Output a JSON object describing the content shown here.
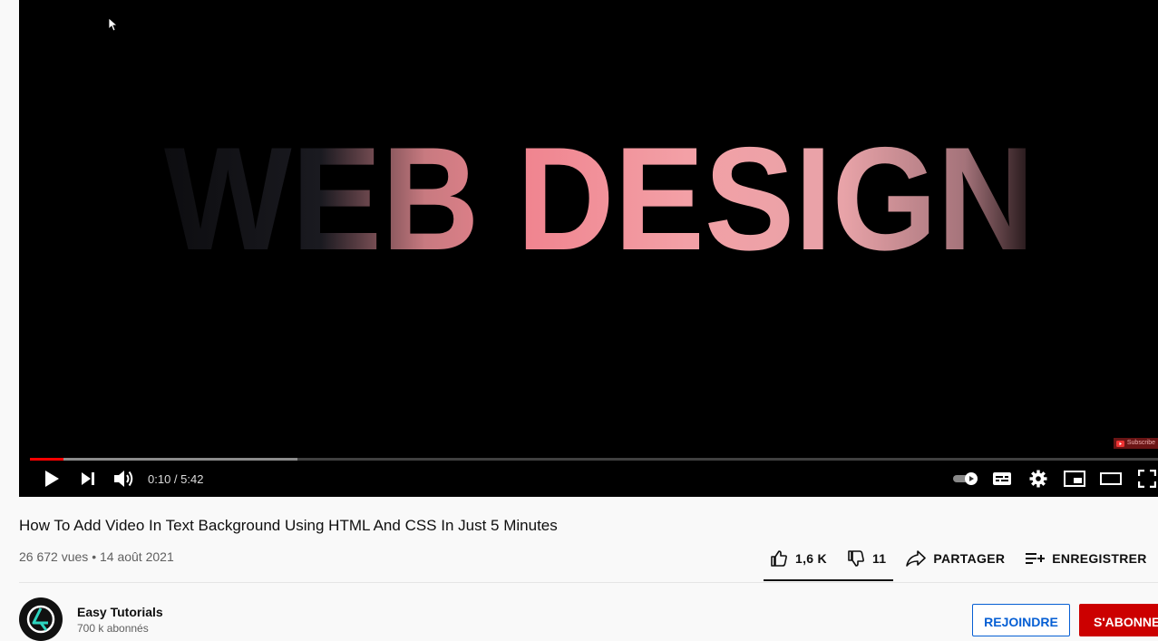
{
  "player": {
    "overlay_text": "WEB DESIGN",
    "subscribe_badge": "Subscribe",
    "time_display": "0:10 / 5:42",
    "progress_played_fraction": 0.03,
    "progress_buffered_fraction": 0.237,
    "accent_color": "#ff0000",
    "controls_left": [
      "play-icon",
      "next-icon",
      "volume-icon"
    ],
    "controls_right": [
      "autoplay-toggle-icon",
      "subtitles-icon",
      "settings-gear-icon",
      "miniplayer-icon",
      "theater-mode-icon",
      "fullscreen-icon"
    ]
  },
  "video": {
    "title": "How To Add Video In Text Background Using HTML And CSS In Just 5 Minutes",
    "views": "26 672 vues",
    "separator": "•",
    "date": "14 août 2021"
  },
  "actions": {
    "likes": "1,6 K",
    "dislikes": "11",
    "share": "PARTAGER",
    "save": "ENREGISTRER",
    "more": "..."
  },
  "channel": {
    "name": "Easy Tutorials",
    "subscribers": "700 k abonnés",
    "join_label": "REJOINDRE",
    "subscribe_label": "S'ABONNER",
    "subscribe_color": "#cc0000"
  }
}
